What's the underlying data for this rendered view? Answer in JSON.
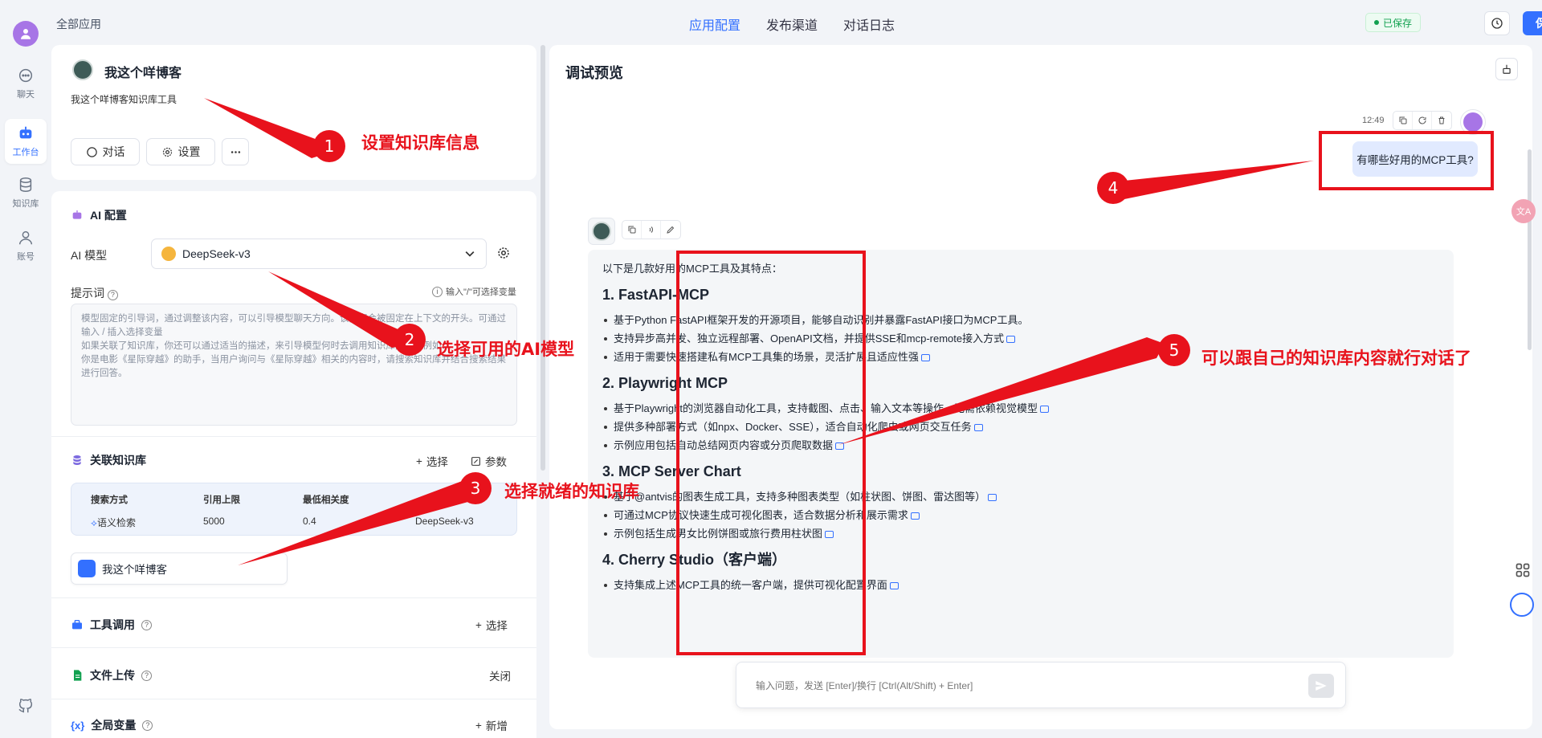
{
  "rail": {
    "items": [
      {
        "label": "聊天"
      },
      {
        "label": "工作台"
      },
      {
        "label": "知识库"
      },
      {
        "label": "账号"
      }
    ]
  },
  "topbar": {
    "breadcrumb": "全部应用",
    "tabs": [
      "应用配置",
      "发布渠道",
      "对话日志"
    ],
    "saved": "已保存",
    "save_label": "保存"
  },
  "app": {
    "name": "我这个咩博客",
    "desc": "我这个咩博客知识库工具",
    "chat_btn": "对话",
    "settings_btn": "设置"
  },
  "ai_config": {
    "title": "AI 配置",
    "model_label": "AI 模型",
    "model": "DeepSeek-v3",
    "prompt_label": "提示词",
    "prompt_hint": "输入\"/\"可选择变量",
    "prompt_text": "模型固定的引导词，通过调整该内容，可以引导模型聊天方向。该内容会被固定在上下文的开头。可通过输入 / 插入选择变量\n如果关联了知识库，你还可以通过适当的描述，来引导模型何时去调用知识库搜索。例如：\n你是电影《星际穿越》的助手，当用户询问与《星际穿越》相关的内容时，请搜索知识库并结合搜索结果进行回答。"
  },
  "kb": {
    "title": "关联知识库",
    "select": "选择",
    "params": "参数",
    "headers": [
      "搜索方式",
      "引用上限",
      "最低相关度"
    ],
    "values": [
      "语义检索",
      "5000",
      "0.4",
      "DeepSeek-v3"
    ],
    "item": "我这个咩博客"
  },
  "tools": {
    "title": "工具调用",
    "action": "选择"
  },
  "upload": {
    "title": "文件上传",
    "action": "关闭"
  },
  "vars": {
    "title": "全局变量",
    "action": "新增"
  },
  "preview": {
    "title": "调试预览",
    "time": "12:49",
    "user_msg": "有哪些好用的MCP工具?",
    "intro": "以下是几款好用的MCP工具及其特点：",
    "sections": [
      {
        "title": "1. FastAPI-MCP",
        "items": [
          "基于Python FastAPI框架开发的开源项目，能够自动识别并暴露FastAPI接口为MCP工具。",
          "支持异步高并发、独立远程部署、OpenAPI文档，并提供SSE和mcp-remote接入方式",
          "适用于需要快速搭建私有MCP工具集的场景，灵活扩展且适应性强"
        ]
      },
      {
        "title": "2. Playwright MCP",
        "items": [
          "基于Playwright的浏览器自动化工具，支持截图、点击、输入文本等操作，无需依赖视觉模型",
          "提供多种部署方式（如npx、Docker、SSE），适合自动化爬虫或网页交互任务",
          "示例应用包括自动总结网页内容或分页爬取数据"
        ]
      },
      {
        "title": "3. MCP Server Chart",
        "items": [
          "基于@antvis的图表生成工具，支持多种图表类型（如柱状图、饼图、雷达图等）",
          "可通过MCP协议快速生成可视化图表，适合数据分析和展示需求",
          "示例包括生成男女比例饼图或旅行费用柱状图"
        ]
      },
      {
        "title": "4. Cherry Studio（客户端）",
        "items": [
          "支持集成上述MCP工具的统一客户端，提供可视化配置界面"
        ]
      }
    ],
    "input_placeholder": "输入问题，发送 [Enter]/换行 [Ctrl(Alt/Shift) + Enter]"
  },
  "annotations": [
    {
      "num": "1",
      "text": "设置知识库信息"
    },
    {
      "num": "2",
      "text": "选择可用的AI模型"
    },
    {
      "num": "3",
      "text": "选择就绪的知识库"
    },
    {
      "num": "4",
      "text": ""
    },
    {
      "num": "5",
      "text": "可以跟自己的知识库内容就行对话了"
    }
  ],
  "colors": {
    "accent": "#3370ff",
    "annotation": "#e8121c",
    "saved": "#12a150"
  }
}
